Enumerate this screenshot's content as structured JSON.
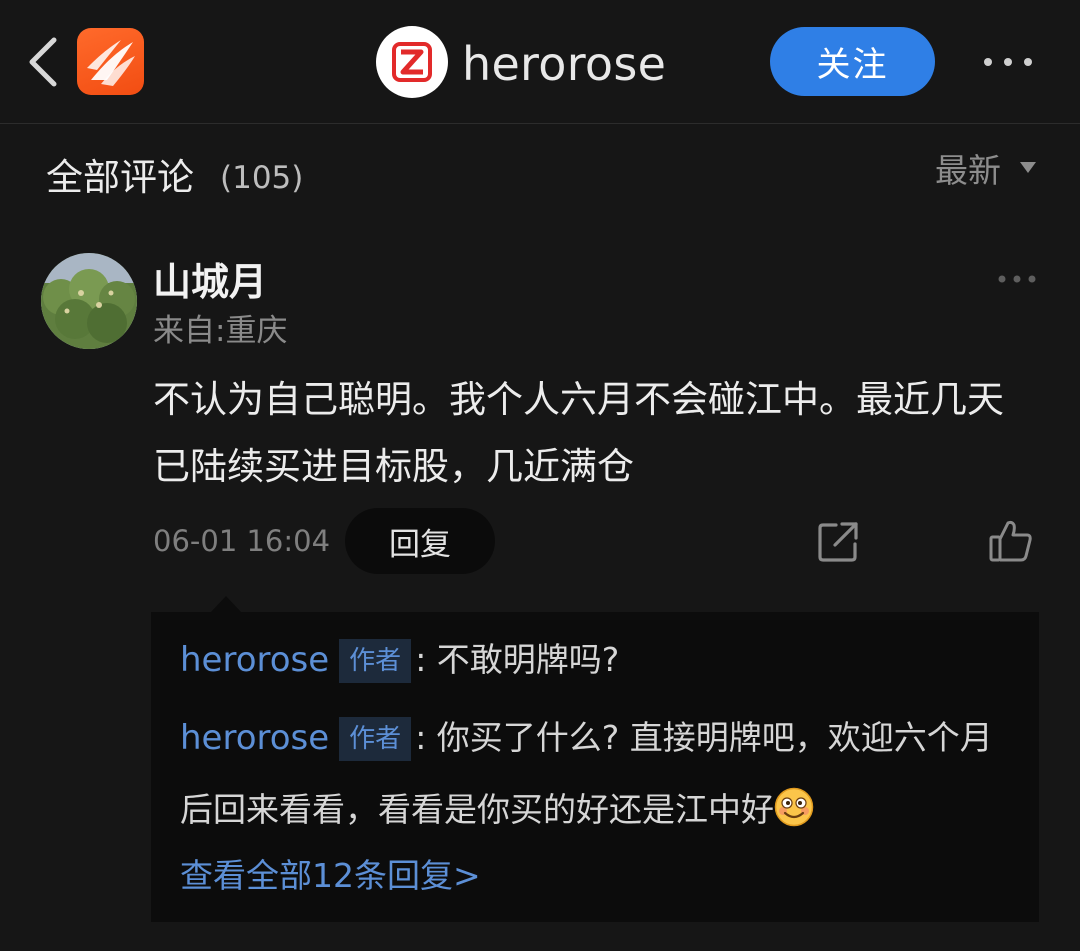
{
  "header": {
    "back_icon": "chevron-left-icon",
    "app_logo_icon": "app-logo-icon",
    "user_logo_icon": "z-logo-icon",
    "user_name": "herorose",
    "follow_label": "关注",
    "more_icon": "more-horizontal-icon"
  },
  "comments": {
    "title": "全部评论",
    "count": "(105)",
    "sort_label": "最新",
    "sort_icon": "caret-down-icon"
  },
  "comment": {
    "author": "山城月",
    "location": "来自:重庆",
    "text": "不认为自己聪明。我个人六月不会碰江中。最近几天已陆续买进目标股，几近满仓",
    "time": "06-01 16:04",
    "reply_label": "回复",
    "share_icon": "share-icon",
    "like_icon": "thumbs-up-icon",
    "more_icon": "more-horizontal-icon",
    "replies": [
      {
        "author": "herorose",
        "tag": "作者",
        "text": ": 不敢明牌吗?"
      },
      {
        "author": "herorose",
        "tag": "作者",
        "text": ": 你买了什么? 直接明牌吧，欢迎六个月后回来看看，看看是你买的好还是江中好",
        "emoji_icon": "grinning-face-icon"
      }
    ],
    "view_all_label": "查看全部12条回复>"
  },
  "colors": {
    "background": "#161616",
    "accent_blue": "#2f7fe6",
    "link_blue": "#5c8fd6",
    "app_orange": "#f24d12"
  }
}
